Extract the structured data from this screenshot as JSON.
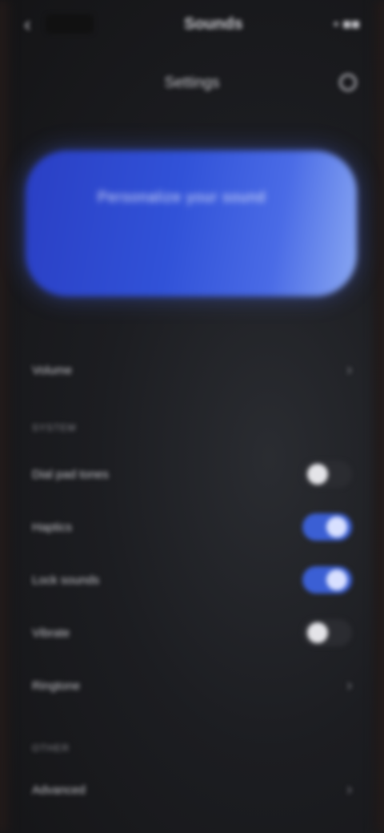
{
  "status_bar": {
    "title": "Sounds",
    "right_text": "• ■■"
  },
  "header": {
    "title": "Settings"
  },
  "hero": {
    "title": "Personalize your sound",
    "subtitle": "",
    "color": "#3152d8"
  },
  "settings": {
    "first_item": "Volume",
    "section_1": "SYSTEM",
    "toggles": [
      {
        "label": "Dial pad tones",
        "on": false
      },
      {
        "label": "Haptics",
        "on": true
      },
      {
        "label": "Lock sounds",
        "on": true
      },
      {
        "label": "Vibrate",
        "on": false
      }
    ],
    "nav_item": "Ringtone",
    "section_2": "OTHER",
    "last_item": "Advanced"
  }
}
